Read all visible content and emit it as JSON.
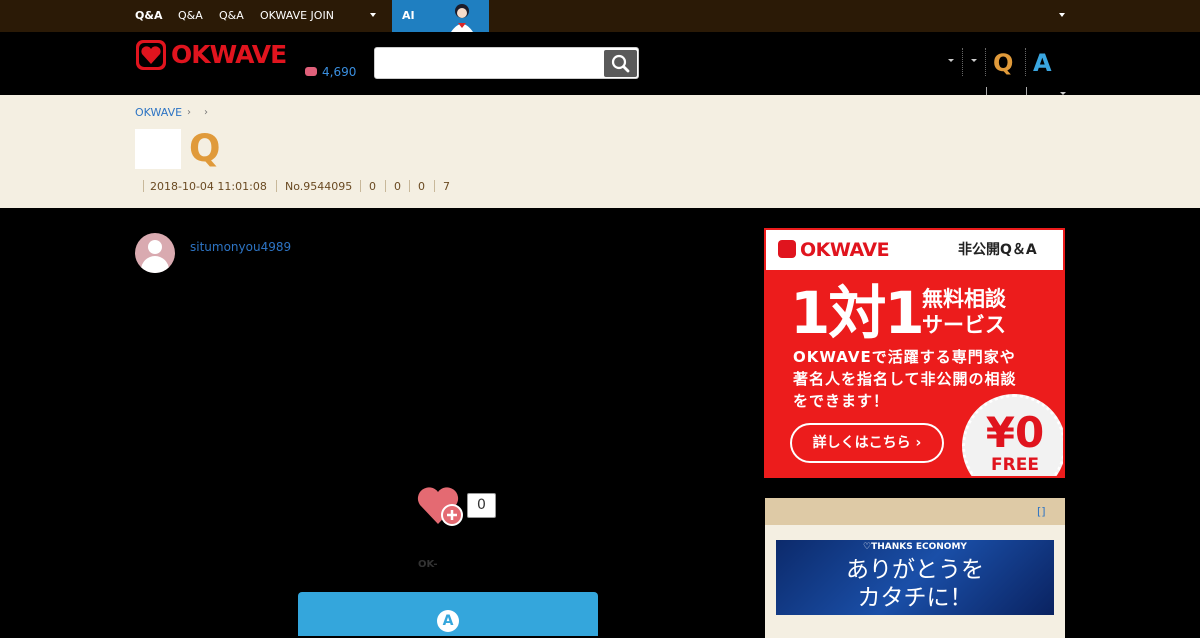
{
  "topnav": {
    "items": [
      "Q&A",
      "Q&A",
      "Q&A",
      "OKWAVE JOIN"
    ],
    "ai_label": "AI"
  },
  "header": {
    "logo": "OKWAVE",
    "points": "4,690",
    "search": {
      "value": "",
      "placeholder": ""
    },
    "q_label": "Q",
    "a_label": "A"
  },
  "question": {
    "breadcrumb": [
      "OKWAVE"
    ],
    "title_letter": "Q",
    "datetime": "2018-10-04 11:01:08",
    "number": "No.9544095",
    "stats": [
      "0",
      "0",
      "0",
      "7"
    ],
    "username": "situmonyou4989",
    "like_count": "0",
    "ok_label": "OK-",
    "answer_label": "A"
  },
  "ad": {
    "logo": "OKWAVE",
    "private_qa": "非公開Q＆A",
    "big_text": "1対1",
    "free_consult_1": "無料相談",
    "free_consult_2": "サービス",
    "desc_1": "OKWAVEで活躍する専門家や",
    "desc_2": "著名人を指名して非公開の相談",
    "desc_3": "をできます！",
    "cta": "詳しくはこちら ›",
    "price": "¥0",
    "free": "FREE"
  },
  "widget": {
    "link": "[]",
    "banner_top": "♡THANKS ECONOMY",
    "banner_line1": "ありがとうを",
    "banner_line2": "カタチに！"
  }
}
